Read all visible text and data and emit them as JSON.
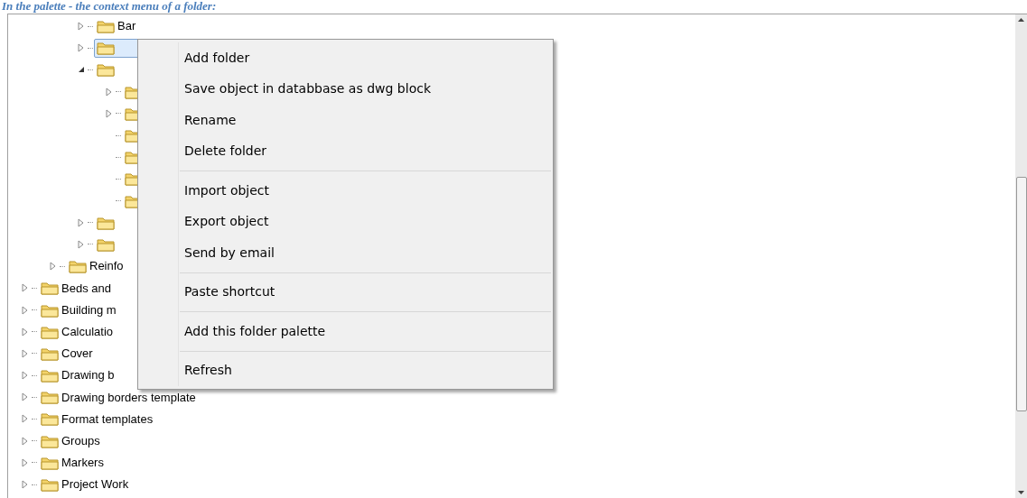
{
  "caption": "In the palette - the context menu of a folder:",
  "tree": [
    {
      "children": [
        {
          "children": [
            {
              "label": "Bar",
              "expanded": false,
              "selected": false
            },
            {
              "expanded": false,
              "selected": true
            },
            {
              "expanded": true,
              "selected": false,
              "children": [
                {
                  "expanded": false,
                  "selected": false
                },
                {
                  "expanded": false,
                  "selected": false
                },
                {
                  "selected": false
                },
                {
                  "selected": false
                },
                {
                  "selected": false
                },
                {
                  "selected": false
                }
              ]
            },
            {
              "expanded": false,
              "selected": false
            },
            {
              "expanded": false,
              "selected": false
            }
          ]
        },
        {
          "label": "Reinfo",
          "expanded": false,
          "selected": false
        }
      ]
    },
    {
      "label": "Beds and",
      "expanded": false,
      "selected": false
    },
    {
      "label": "Building m",
      "expanded": false,
      "selected": false
    },
    {
      "label": "Calculatio",
      "expanded": false,
      "selected": false
    },
    {
      "label": "Cover",
      "expanded": false,
      "selected": false
    },
    {
      "label": "Drawing b",
      "expanded": false,
      "selected": false
    },
    {
      "label": "Drawing borders template",
      "expanded": false,
      "selected": false
    },
    {
      "label": "Format templates",
      "expanded": false,
      "selected": false
    },
    {
      "label": "Groups",
      "expanded": false,
      "selected": false
    },
    {
      "label": "Markers",
      "expanded": false,
      "selected": false
    },
    {
      "label": "Project Work",
      "expanded": false,
      "selected": false
    }
  ],
  "context_menu": [
    {
      "kind": "item",
      "label": "Add folder"
    },
    {
      "kind": "item",
      "label": "Save object in databbase as dwg block"
    },
    {
      "kind": "item",
      "label": "Rename"
    },
    {
      "kind": "item",
      "label": "Delete folder"
    },
    {
      "kind": "separator"
    },
    {
      "kind": "item",
      "label": "Import object"
    },
    {
      "kind": "item",
      "label": "Export object"
    },
    {
      "kind": "item",
      "label": "Send by email"
    },
    {
      "kind": "separator"
    },
    {
      "kind": "item",
      "label": "Paste shortcut"
    },
    {
      "kind": "separator"
    },
    {
      "kind": "item",
      "label": "Add this folder palette"
    },
    {
      "kind": "separator"
    },
    {
      "kind": "item",
      "label": "Refresh"
    }
  ]
}
